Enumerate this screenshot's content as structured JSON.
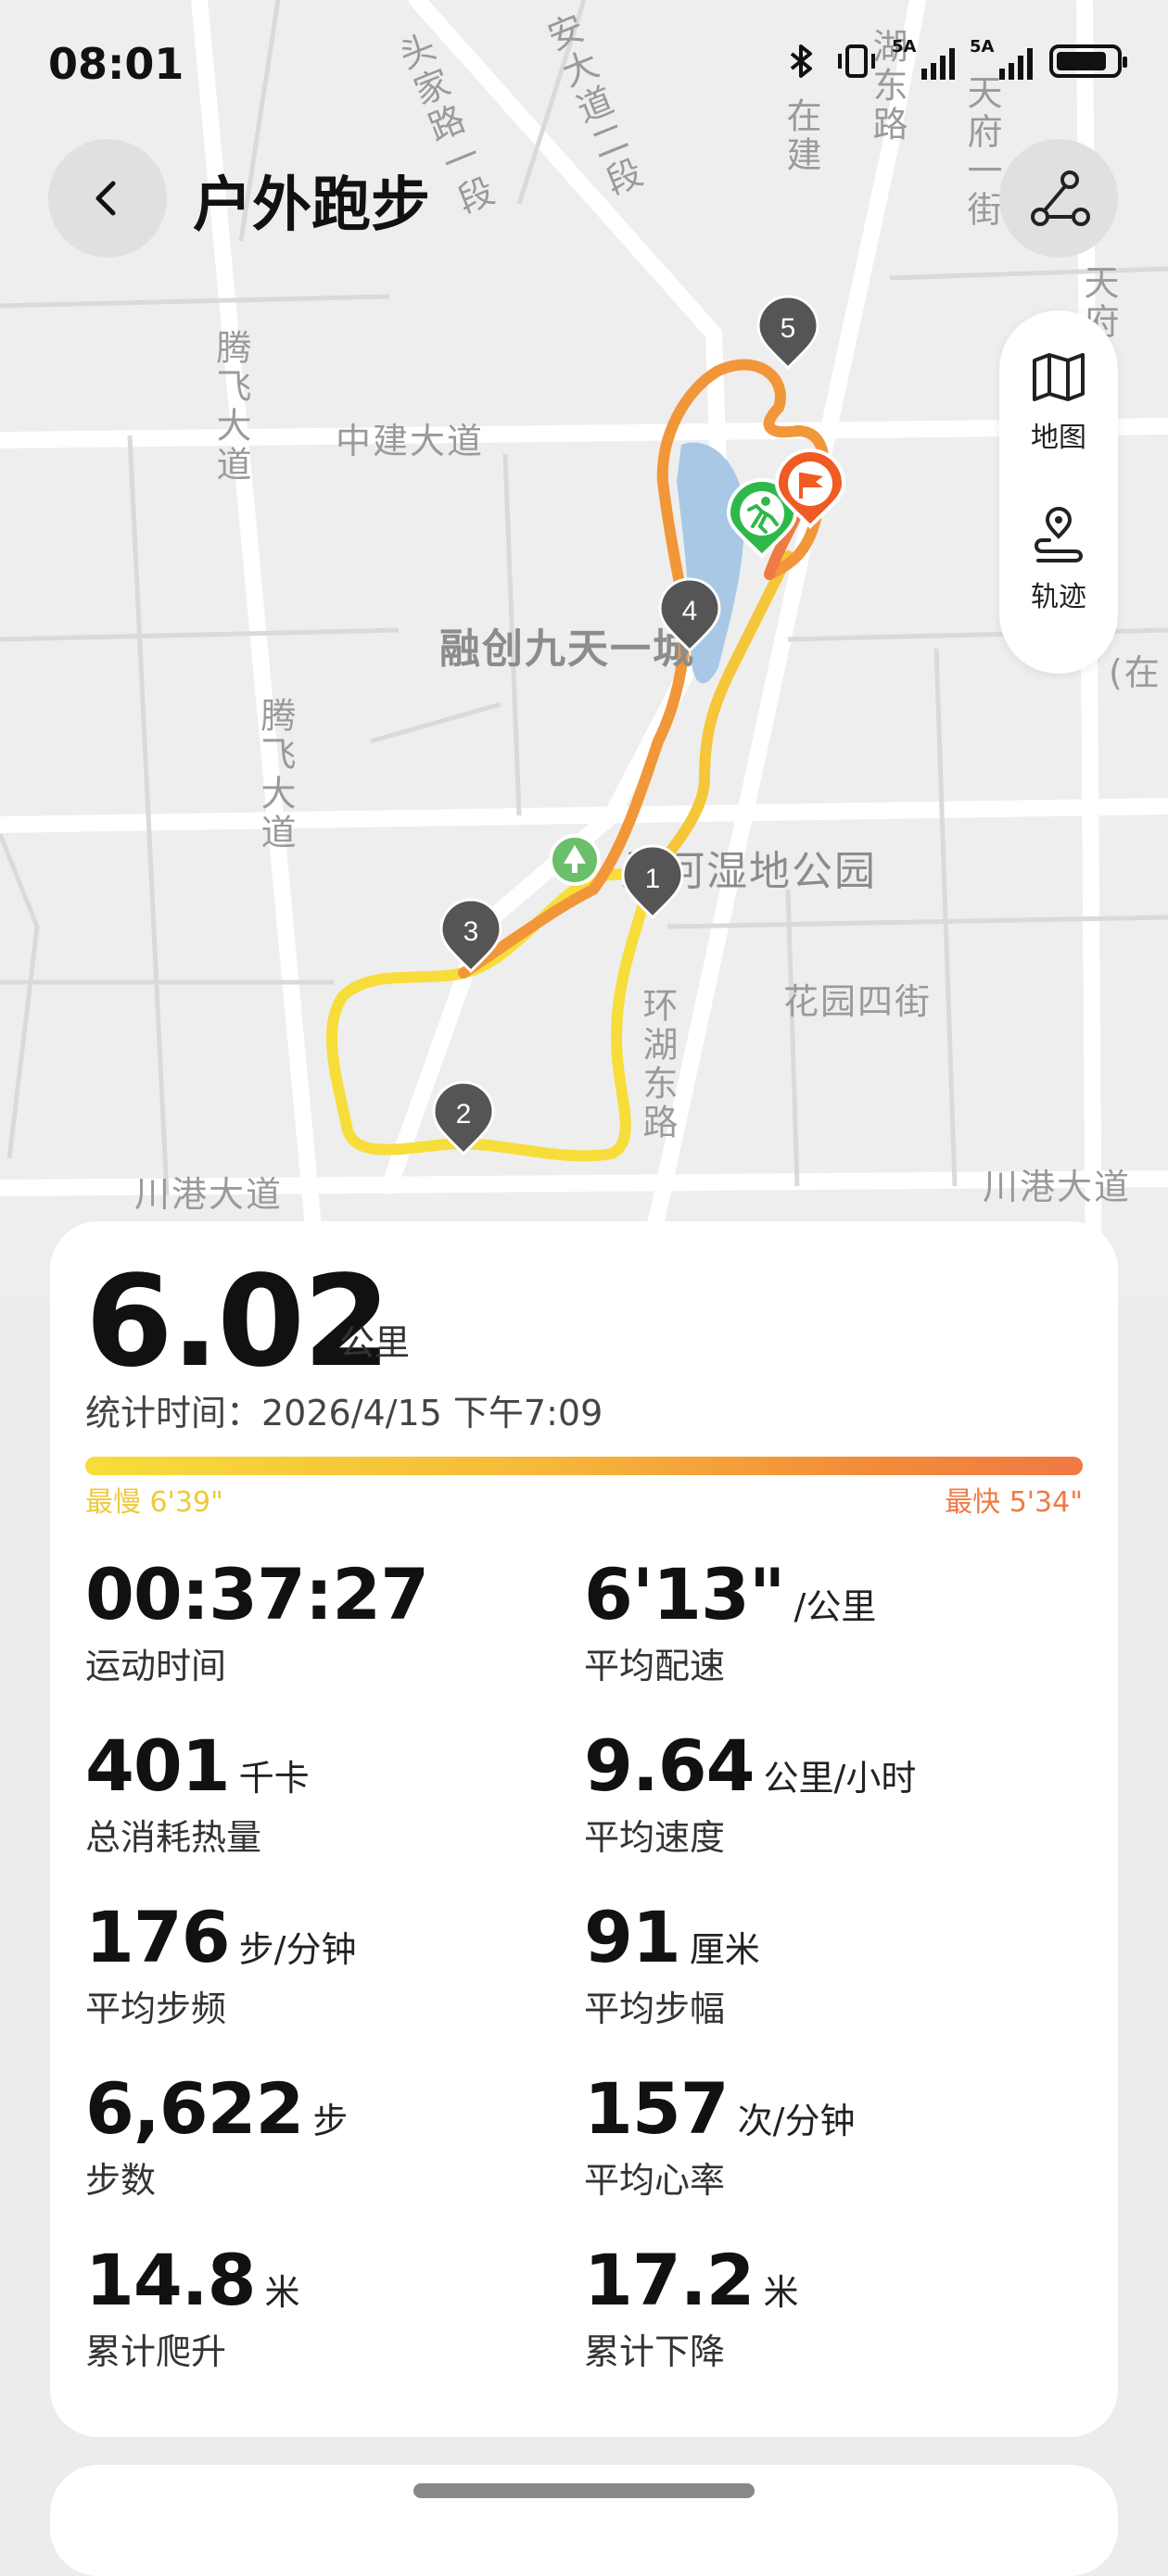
{
  "status_bar": {
    "time": "08:01",
    "network_1": "5A",
    "network_2": "5A"
  },
  "header": {
    "title": "户外跑步"
  },
  "side_panel": {
    "map_label": "地图",
    "track_label": "轨迹"
  },
  "map": {
    "road_labels": [
      "腾飞大道",
      "腾飞大道",
      "中建大道",
      "川港大道",
      "川港大道",
      "环湖东路",
      "花园四街",
      "头家路一段",
      "安大道二段",
      "在建",
      "湖东路",
      "天府一街",
      "天府",
      "(在"
    ],
    "poi_labels": [
      "融创九天一城",
      "桑河湿地公园"
    ],
    "km_markers": [
      "1",
      "2",
      "3",
      "4",
      "5"
    ]
  },
  "summary": {
    "distance_value": "6.02",
    "distance_unit": "公里",
    "stat_time": "统计时间：2026/4/15 下午7:09",
    "slowest": "最慢 6'39\"",
    "fastest": "最快 5'34\""
  },
  "metrics": [
    {
      "value": "00:37:27",
      "unit": "",
      "label": "运动时间"
    },
    {
      "value": "6'13\"",
      "unit": "/公里",
      "label": "平均配速"
    },
    {
      "value": "401",
      "unit": "千卡",
      "label": "总消耗热量"
    },
    {
      "value": "9.64",
      "unit": "公里/小时",
      "label": "平均速度"
    },
    {
      "value": "176",
      "unit": "步/分钟",
      "label": "平均步频"
    },
    {
      "value": "91",
      "unit": "厘米",
      "label": "平均步幅"
    },
    {
      "value": "6,622",
      "unit": "步",
      "label": "步数"
    },
    {
      "value": "157",
      "unit": "次/分钟",
      "label": "平均心率"
    },
    {
      "value": "14.8",
      "unit": "米",
      "label": "累计爬升"
    },
    {
      "value": "17.2",
      "unit": "米",
      "label": "累计下降"
    }
  ],
  "colors": {
    "pace_slow": "#f7dd3a",
    "pace_fast": "#ef7a45",
    "start_marker": "#2fb84a",
    "finish_marker": "#f05a23"
  }
}
